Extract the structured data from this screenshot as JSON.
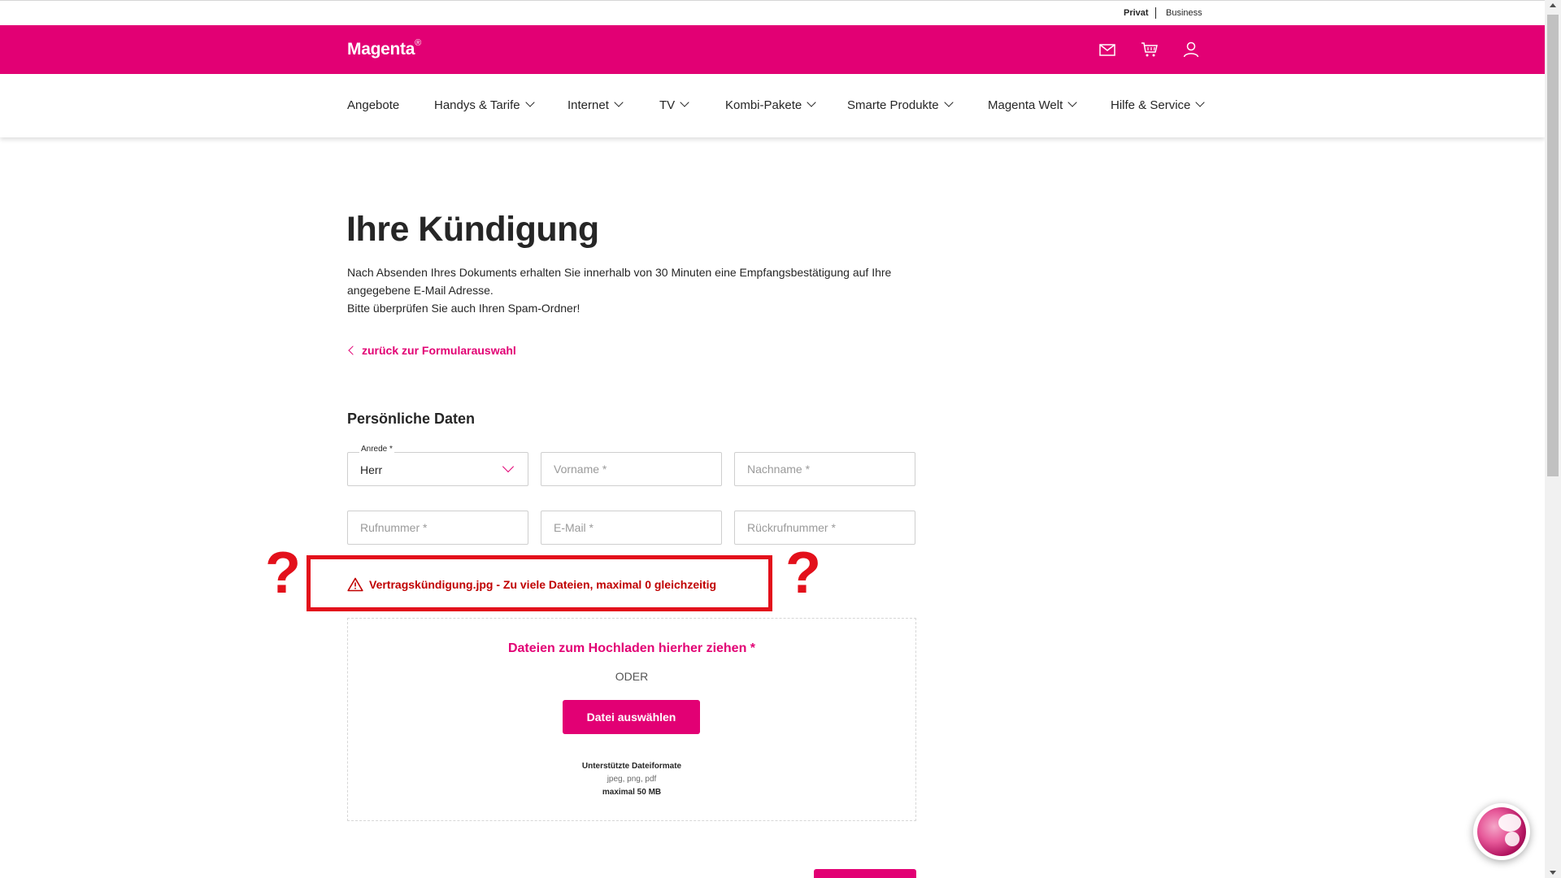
{
  "topbar": {
    "privat": "Privat",
    "business": "Business"
  },
  "header": {
    "logo": "Magenta",
    "logo_mark": "®",
    "icons": [
      "mail-icon",
      "cart-icon",
      "user-icon"
    ]
  },
  "nav": {
    "items": [
      {
        "label": "Angebote"
      },
      {
        "label": "Handys & Tarife"
      },
      {
        "label": "Internet"
      },
      {
        "label": "TV"
      },
      {
        "label": "Kombi-Pakete"
      },
      {
        "label": "Smarte Produkte"
      },
      {
        "label": "Magenta Welt"
      },
      {
        "label": "Hilfe & Service"
      }
    ]
  },
  "main": {
    "title": "Ihre Kündigung",
    "intro_line1": "Nach Absenden Ihres Dokuments erhalten Sie innerhalb von 30 Minuten eine Empfangsbestätigung auf Ihre angegebene E-Mail Adresse.",
    "intro_line2": "Bitte überprüfen Sie auch Ihren Spam-Ordner!",
    "back_link": "zurück zur Formularauswahl",
    "section_title": "Persönliche Daten"
  },
  "form": {
    "anrede_label": "Anrede *",
    "anrede_value": "Herr",
    "vorname_placeholder": "Vorname *",
    "nachname_placeholder": "Nachname *",
    "rufnummer_placeholder": "Rufnummer *",
    "email_placeholder": "E-Mail *",
    "rueckruf_placeholder": "Rückrufnummer *"
  },
  "error": {
    "message": "Vertragskündigung.jpg - Zu viele Dateien, maximal 0 gleichzeitig",
    "annotation_mark": "?"
  },
  "upload": {
    "title": "Dateien zum Hochladen hierher ziehen *",
    "or": "ODER",
    "button": "Datei auswählen",
    "formats_title": "Unterstützte Dateiformate",
    "formats": "jpeg, png, pdf",
    "max_size": "maximal 50 MB"
  },
  "colors": {
    "brand": "#e20074",
    "error": "#c00000",
    "annotation": "#e3101b"
  }
}
